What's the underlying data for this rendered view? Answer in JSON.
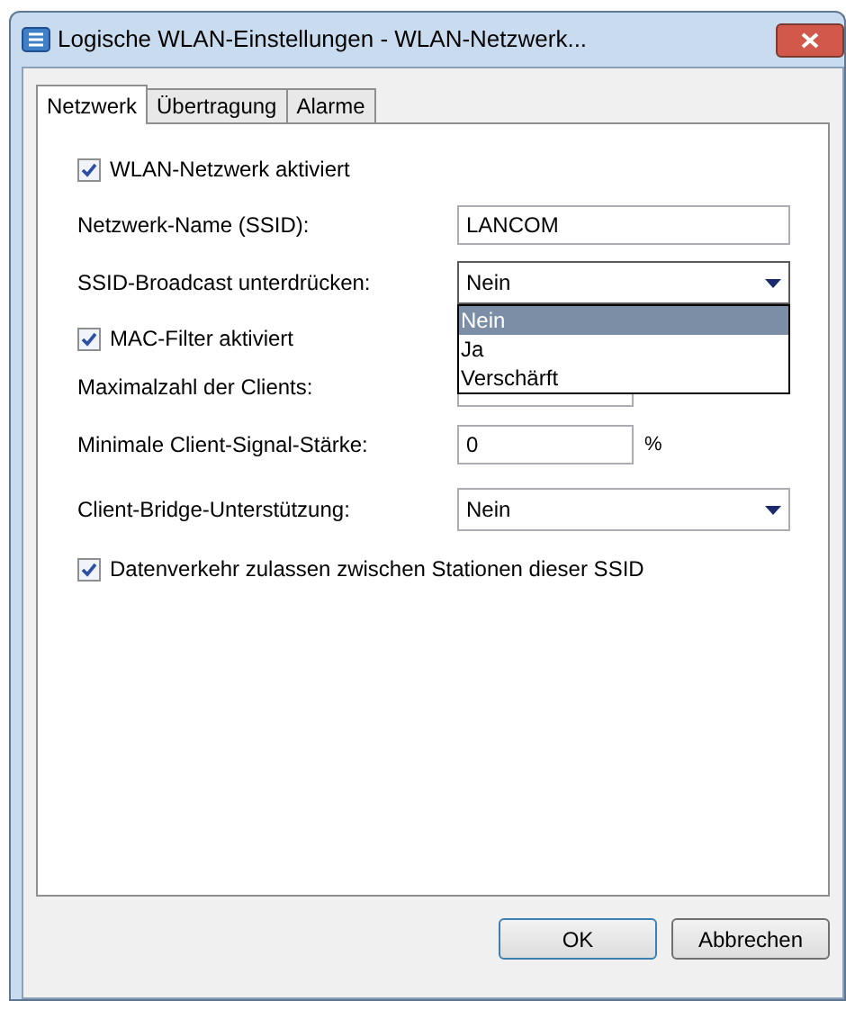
{
  "window": {
    "title": "Logische WLAN-Einstellungen - WLAN-Netzwerk..."
  },
  "tabs": [
    {
      "label": "Netzwerk",
      "selected": true
    },
    {
      "label": "Übertragung",
      "selected": false
    },
    {
      "label": "Alarme",
      "selected": false
    }
  ],
  "fields": [
    {
      "kind": "checkbox",
      "label": "WLAN-Netzwerk aktiviert",
      "checked": true
    },
    {
      "kind": "text",
      "label": "Netzwerk-Name (SSID):",
      "value": "LANCOM"
    },
    {
      "kind": "select",
      "label": "SSID-Broadcast unterdrücken:",
      "value": "Nein",
      "expanded": true,
      "options": [
        {
          "label": "Nein",
          "selected": true
        },
        {
          "label": "Ja",
          "selected": false
        },
        {
          "label": "Verschärft",
          "selected": false
        }
      ]
    },
    {
      "kind": "checkbox",
      "label": "MAC-Filter aktiviert",
      "checked": true
    },
    {
      "kind": "number",
      "label": "Maximalzahl der Clients:"
    },
    {
      "kind": "number",
      "label": "Minimale Client-Signal-Stärke:",
      "value": "0",
      "unit": "%"
    },
    {
      "kind": "select",
      "label": "Client-Bridge-Unterstützung:",
      "value": "Nein",
      "expanded": false
    },
    {
      "kind": "checkbox",
      "label": "Datenverkehr zulassen zwischen Stationen dieser SSID",
      "checked": true
    }
  ],
  "buttons": [
    "OK",
    "Abbrechen"
  ]
}
